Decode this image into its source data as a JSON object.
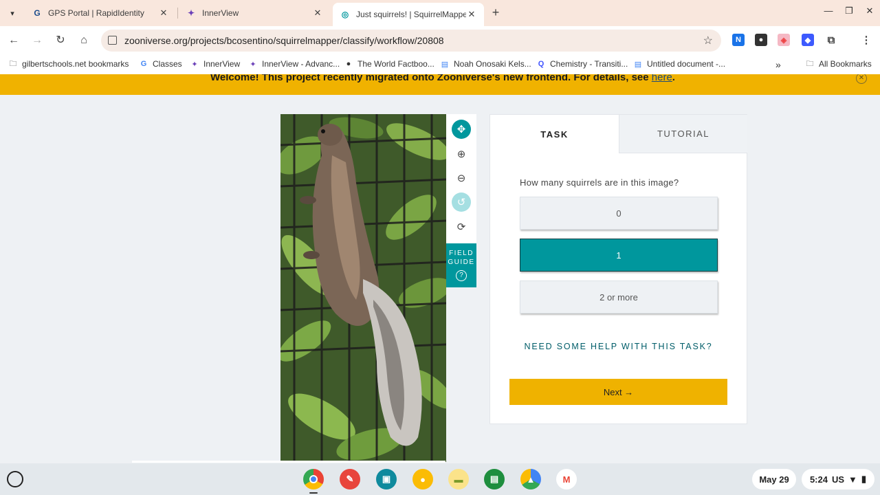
{
  "browser": {
    "tabs": [
      {
        "title": "GPS Portal | RapidIdentity",
        "icon": "G",
        "active": false
      },
      {
        "title": "InnerView",
        "icon": "innerview-icon",
        "active": false
      },
      {
        "title": "Just squirrels! | SquirrelMapper",
        "icon": "zooniverse-icon",
        "active": true
      }
    ],
    "url": "zooniverse.org/projects/bcosentino/squirrelmapper/classify/workflow/20808",
    "bookmarks": [
      {
        "label": "gilbertschools.net bookmarks",
        "icon": "folder-managed-icon"
      },
      {
        "label": "Classes",
        "icon": "google-icon"
      },
      {
        "label": "InnerView",
        "icon": "innerview-icon"
      },
      {
        "label": "InnerView - Advanc...",
        "icon": "innerview-icon"
      },
      {
        "label": "The World Factboo...",
        "icon": "cia-seal-icon"
      },
      {
        "label": "Noah Onosaki Kels...",
        "icon": "docs-icon"
      },
      {
        "label": "Chemistry - Transiti...",
        "icon": "quizlet-icon"
      },
      {
        "label": "Untitled document -...",
        "icon": "docs-icon"
      }
    ],
    "all_bookmarks": "All Bookmarks",
    "more_bookmarks": "»"
  },
  "banner": {
    "text": "Welcome! This project recently migrated onto Zooniverse's new frontend. For details, see ",
    "link": "here",
    "suffix": "."
  },
  "tools": {
    "field_guide_line1": "FIELD",
    "field_guide_line2": "GUIDE",
    "help_glyph": "?"
  },
  "task_panel": {
    "tabs": [
      "TASK",
      "TUTORIAL"
    ],
    "question": "How many squirrels are in this image?",
    "answers": [
      {
        "label": "0",
        "selected": false
      },
      {
        "label": "1",
        "selected": true
      },
      {
        "label": "2 or more",
        "selected": false
      }
    ],
    "help_link": "NEED SOME HELP WITH THIS TASK?",
    "next_label": "Next →"
  },
  "shelf": {
    "date": "May 29",
    "time": "5:24",
    "locale": "US"
  },
  "colors": {
    "accent_teal": "#00979d",
    "banner_yellow": "#f0b200",
    "next_yellow": "#efb200"
  }
}
